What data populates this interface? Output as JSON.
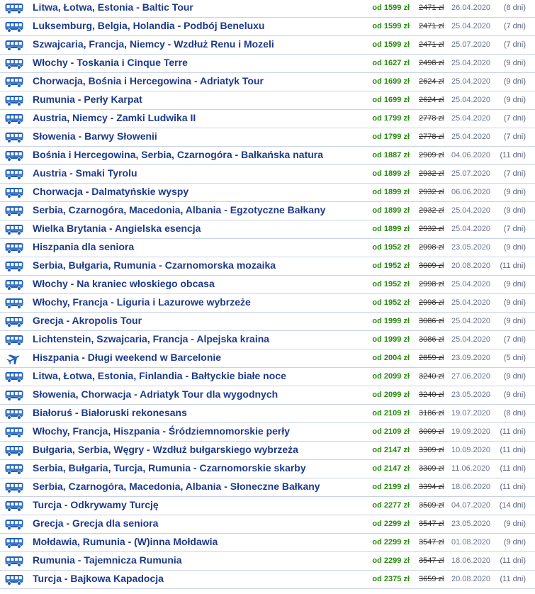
{
  "colors": {
    "title": "#1e3a8a",
    "price": "#2a8a12",
    "icon": "#1e5fb8",
    "divider": "#c9d3e6"
  },
  "tours": [
    {
      "icon": "bus-icon",
      "title": "Litwa, Łotwa, Estonia - Baltic Tour",
      "price": "od 1599 zł",
      "old_price": "2471 zł",
      "date": "26.04.2020",
      "days": "(8 dni)"
    },
    {
      "icon": "bus-icon",
      "title": "Luksemburg, Belgia, Holandia - Podbój Beneluxu",
      "price": "od 1599 zł",
      "old_price": "2471 zł",
      "date": "25.04.2020",
      "days": "(7 dni)"
    },
    {
      "icon": "bus-icon",
      "title": "Szwajcaria, Francja, Niemcy - Wzdłuż Renu i Mozeli",
      "price": "od 1599 zł",
      "old_price": "2471 zł",
      "date": "25.07.2020",
      "days": "(7 dni)"
    },
    {
      "icon": "bus-icon",
      "title": "Włochy - Toskania i Cinque Terre",
      "price": "od 1627 zł",
      "old_price": "2498 zł",
      "date": "25.04.2020",
      "days": "(9 dni)"
    },
    {
      "icon": "bus-icon",
      "title": "Chorwacja, Bośnia i Hercegowina - Adriatyk Tour",
      "price": "od 1699 zł",
      "old_price": "2624 zł",
      "date": "25.04.2020",
      "days": "(9 dni)"
    },
    {
      "icon": "bus-icon",
      "title": "Rumunia - Perły Karpat",
      "price": "od 1699 zł",
      "old_price": "2624 zł",
      "date": "25.04.2020",
      "days": "(9 dni)"
    },
    {
      "icon": "bus-icon",
      "title": "Austria, Niemcy - Zamki Ludwika II",
      "price": "od 1799 zł",
      "old_price": "2778 zł",
      "date": "25.04.2020",
      "days": "(7 dni)"
    },
    {
      "icon": "bus-icon",
      "title": "Słowenia - Barwy Słowenii",
      "price": "od 1799 zł",
      "old_price": "2778 zł",
      "date": "25.04.2020",
      "days": "(7 dni)"
    },
    {
      "icon": "bus-icon",
      "title": "Bośnia i Hercegowina, Serbia, Czarnogóra - Bałkańska natura",
      "price": "od 1887 zł",
      "old_price": "2909 zł",
      "date": "04.06.2020",
      "days": "(11 dni)"
    },
    {
      "icon": "bus-icon",
      "title": "Austria - Smaki Tyrolu",
      "price": "od 1899 zł",
      "old_price": "2932 zł",
      "date": "25.07.2020",
      "days": "(7 dni)"
    },
    {
      "icon": "bus-icon",
      "title": "Chorwacja - Dalmatyńskie wyspy",
      "price": "od 1899 zł",
      "old_price": "2932 zł",
      "date": "06.06.2020",
      "days": "(9 dni)"
    },
    {
      "icon": "bus-icon",
      "title": "Serbia, Czarnogóra, Macedonia, Albania - Egzotyczne Bałkany",
      "price": "od 1899 zł",
      "old_price": "2932 zł",
      "date": "25.04.2020",
      "days": "(9 dni)"
    },
    {
      "icon": "bus-icon",
      "title": "Wielka Brytania - Angielska esencja",
      "price": "od 1899 zł",
      "old_price": "2932 zł",
      "date": "25.04.2020",
      "days": "(7 dni)"
    },
    {
      "icon": "bus-icon",
      "title": "Hiszpania dla seniora",
      "price": "od 1952 zł",
      "old_price": "2998 zł",
      "date": "23.05.2020",
      "days": "(9 dni)"
    },
    {
      "icon": "bus-icon",
      "title": "Serbia, Bułgaria, Rumunia - Czarnomorska mozaika",
      "price": "od 1952 zł",
      "old_price": "3009 zł",
      "date": "20.08.2020",
      "days": "(11 dni)"
    },
    {
      "icon": "bus-icon",
      "title": "Włochy - Na kraniec włoskiego obcasa",
      "price": "od 1952 zł",
      "old_price": "2998 zł",
      "date": "25.04.2020",
      "days": "(9 dni)"
    },
    {
      "icon": "bus-icon",
      "title": "Włochy, Francja - Liguria i Lazurowe wybrzeże",
      "price": "od 1952 zł",
      "old_price": "2998 zł",
      "date": "25.04.2020",
      "days": "(9 dni)"
    },
    {
      "icon": "bus-icon",
      "title": "Grecja - Akropolis Tour",
      "price": "od 1999 zł",
      "old_price": "3086 zł",
      "date": "25.04.2020",
      "days": "(9 dni)"
    },
    {
      "icon": "bus-icon",
      "title": "Lichtenstein, Szwajcaria, Francja - Alpejska kraina",
      "price": "od 1999 zł",
      "old_price": "3086 zł",
      "date": "25.04.2020",
      "days": "(7 dni)"
    },
    {
      "icon": "plane-icon",
      "title": "Hiszpania - Długi weekend w Barcelonie",
      "price": "od 2004 zł",
      "old_price": "2859 zł",
      "date": "23.09.2020",
      "days": "(5 dni)"
    },
    {
      "icon": "bus-icon",
      "title": "Litwa, Łotwa, Estonia, Finlandia - Bałtyckie białe noce",
      "price": "od 2099 zł",
      "old_price": "3240 zł",
      "date": "27.06.2020",
      "days": "(9 dni)"
    },
    {
      "icon": "bus-icon",
      "title": "Słowenia, Chorwacja - Adriatyk Tour dla wygodnych",
      "price": "od 2099 zł",
      "old_price": "3240 zł",
      "date": "23.05.2020",
      "days": "(9 dni)"
    },
    {
      "icon": "bus-icon",
      "title": "Białoruś - Białoruski rekonesans",
      "price": "od 2109 zł",
      "old_price": "3186 zł",
      "date": "19.07.2020",
      "days": "(8 dni)"
    },
    {
      "icon": "bus-icon",
      "title": "Włochy, Francja, Hiszpania - Śródziemnomorskie perły",
      "price": "od 2109 zł",
      "old_price": "3009 zł",
      "date": "19.09.2020",
      "days": "(11 dni)"
    },
    {
      "icon": "bus-icon",
      "title": "Bułgaria, Serbia, Węgry - Wzdłuż bułgarskiego wybrzeża",
      "price": "od 2147 zł",
      "old_price": "3309 zł",
      "date": "10.09.2020",
      "days": "(11 dni)"
    },
    {
      "icon": "bus-icon",
      "title": "Serbia, Bułgaria, Turcja, Rumunia - Czarnomorskie skarby",
      "price": "od 2147 zł",
      "old_price": "3309 zł",
      "date": "11.06.2020",
      "days": "(11 dni)"
    },
    {
      "icon": "bus-icon",
      "title": "Serbia, Czarnogóra, Macedonia, Albania - Słoneczne Bałkany",
      "price": "od 2199 zł",
      "old_price": "3394 zł",
      "date": "18.06.2020",
      "days": "(11 dni)"
    },
    {
      "icon": "bus-icon",
      "title": "Turcja - Odkrywamy Turcję",
      "price": "od 2277 zł",
      "old_price": "3509 zł",
      "date": "04.07.2020",
      "days": "(14 dni)"
    },
    {
      "icon": "bus-icon",
      "title": "Grecja - Grecja dla seniora",
      "price": "od 2299 zł",
      "old_price": "3547 zł",
      "date": "23.05.2020",
      "days": "(9 dni)"
    },
    {
      "icon": "bus-icon",
      "title": "Mołdawia, Rumunia - (W)inna Mołdawia",
      "price": "od 2299 zł",
      "old_price": "3547 zł",
      "date": "01.08.2020",
      "days": "(9 dni)"
    },
    {
      "icon": "bus-icon",
      "title": "Rumunia - Tajemnicza Rumunia",
      "price": "od 2299 zł",
      "old_price": "3547 zł",
      "date": "18.06.2020",
      "days": "(11 dni)"
    },
    {
      "icon": "bus-icon",
      "title": "Turcja - Bajkowa Kapadocja",
      "price": "od 2375 zł",
      "old_price": "3659 zł",
      "date": "20.08.2020",
      "days": "(11 dni)"
    }
  ]
}
